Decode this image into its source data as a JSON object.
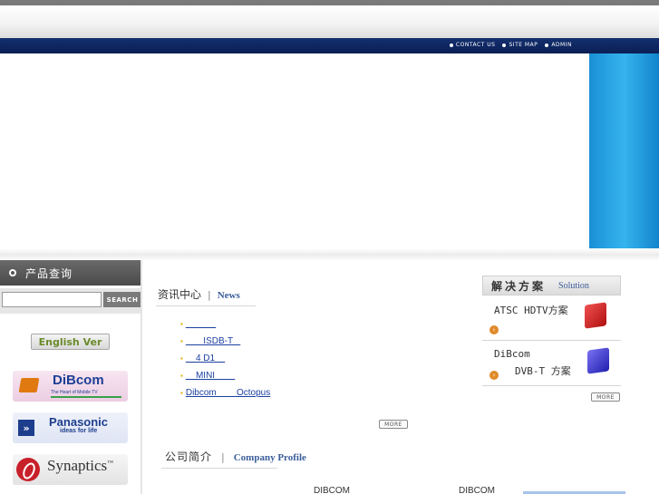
{
  "nav": {
    "links": [
      "CONTACT US",
      "SITE MAP",
      "ADMIN"
    ]
  },
  "sidebar": {
    "header_label": "产品查询",
    "search": {
      "value": "",
      "button_label": "SEARCH"
    },
    "english_button": "English Ver",
    "partners": {
      "dibcom": {
        "name": "DiBcom",
        "tagline": "The Heart of Mobile TV"
      },
      "panasonic": {
        "name": "Panasonic",
        "tagline": "ideas for life"
      },
      "synaptics": {
        "name": "Synaptics",
        "tm": "™"
      }
    }
  },
  "news": {
    "title_cn": "资讯中心",
    "title_sep": "|",
    "title_en": "News",
    "items": [
      "            ",
      "       ISDB-T   ",
      "    4 D1    ",
      "    MINI        ",
      "Dibcom        Octopus"
    ],
    "more_label": "MORE"
  },
  "solution": {
    "title_cn": "解决方案",
    "title_en": "Solution",
    "items": [
      {
        "line1": "ATSC HDTV方案",
        "line2": ""
      },
      {
        "line1": "DiBcom",
        "line2": "DVB-T 方案"
      }
    ],
    "more_label": "MORE"
  },
  "company": {
    "title_cn": "公司简介",
    "title_sep": "|",
    "title_en": "Company Profile",
    "text_1": "DIBCOM",
    "text_2": "DIBCOM"
  },
  "colors": {
    "nav_bg": "#0f2a66",
    "hero_accent": "#2aa3e3",
    "link": "#1a3fa0",
    "heading_en": "#3b5d9a"
  }
}
